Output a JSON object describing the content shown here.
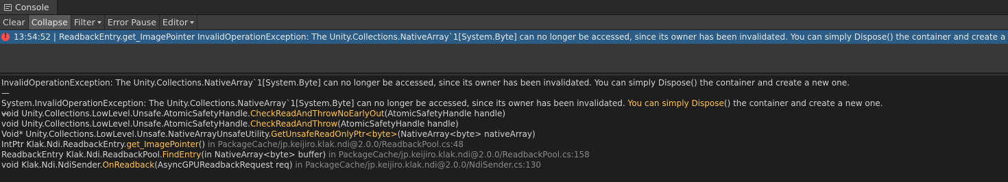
{
  "window": {
    "tab_title": "Console",
    "tab_icon": "console-icon"
  },
  "toolbar": {
    "clear": "Clear",
    "collapse": "Collapse",
    "filter": "Filter",
    "error_pause": "Error Pause",
    "editor": "Editor"
  },
  "log": {
    "entries": [
      {
        "icon": "error-icon",
        "time": "13:54:52",
        "separator": "|",
        "message": "ReadbackEntry.get_ImagePointer  InvalidOperationException: The Unity.Collections.NativeArray`1[System.Byte] can no longer be accessed, since its owner has been invalidated. You can simply Dispose() the container and create a new one."
      }
    ]
  },
  "detail": {
    "summary": "InvalidOperationException: The Unity.Collections.NativeArray`1[System.Byte] can no longer be accessed, since its owner has been invalidated. You can simply Dispose() the container and create a new one.",
    "dash1": "—",
    "dash2": "—",
    "stack": [
      [
        {
          "t": "System.InvalidOperationException: The Unity.Collections.NativeArray`1[System.Byte] can no longer be accessed, since its owner has been invalidated. ",
          "s": "n"
        },
        {
          "t": "You can simply Dispose",
          "s": "y"
        },
        {
          "t": "() the container and create a new one.",
          "s": "n"
        }
      ],
      [
        {
          "t": "void Unity.Collections.LowLevel.Unsafe.AtomicSafetyHandle.",
          "s": "n"
        },
        {
          "t": "CheckReadAndThrowNoEarlyOut",
          "s": "y"
        },
        {
          "t": "(AtomicSafetyHandle handle)",
          "s": "n"
        }
      ],
      [
        {
          "t": "void Unity.Collections.LowLevel.Unsafe.AtomicSafetyHandle.",
          "s": "n"
        },
        {
          "t": "CheckReadAndThrow",
          "s": "y"
        },
        {
          "t": "(AtomicSafetyHandle handle)",
          "s": "n"
        }
      ],
      [
        {
          "t": "Void* Unity.Collections.LowLevel.Unsafe.NativeArrayUnsafeUtility.",
          "s": "n"
        },
        {
          "t": "GetUnsafeReadOnlyPtr<byte>",
          "s": "y"
        },
        {
          "t": "(NativeArray<byte> nativeArray)",
          "s": "n"
        }
      ],
      [
        {
          "t": "IntPtr Klak.Ndi.ReadbackEntry.",
          "s": "n"
        },
        {
          "t": "get_ImagePointer",
          "s": "y"
        },
        {
          "t": "()",
          "s": "n"
        },
        {
          "t": " in PackageCache/jp.keijiro.klak.ndi@2.0.0/ReadbackPool.cs:48",
          "s": "g"
        }
      ],
      [
        {
          "t": "ReadbackEntry Klak.Ndi.ReadbackPool.",
          "s": "n"
        },
        {
          "t": "FindEntry",
          "s": "y"
        },
        {
          "t": "(in NativeArray<byte> buffer)",
          "s": "n"
        },
        {
          "t": " in PackageCache/jp.keijiro.klak.ndi@2.0.0/ReadbackPool.cs:158",
          "s": "g"
        }
      ],
      [
        {
          "t": "void Klak.Ndi.NdiSender.",
          "s": "n"
        },
        {
          "t": "OnReadback",
          "s": "y"
        },
        {
          "t": "(AsyncGPUReadbackRequest req)",
          "s": "n"
        },
        {
          "t": " in PackageCache/jp.keijiro.klak.ndi@2.0.0/NdiSender.cs:130",
          "s": "g"
        }
      ]
    ]
  },
  "colors": {
    "selected_row": "#2c5d87",
    "method_highlight": "#ffc44d",
    "path_gray": "#8a8a8a",
    "error_red": "#ff4d4d"
  }
}
